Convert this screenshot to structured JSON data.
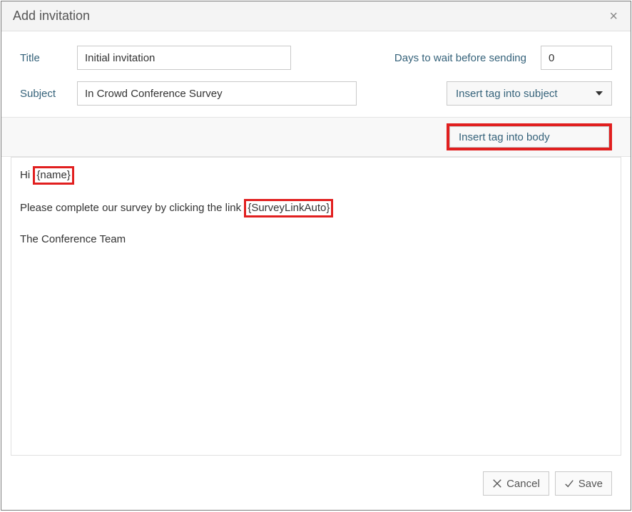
{
  "dialog": {
    "title": "Add invitation",
    "close_symbol": "×"
  },
  "form": {
    "title_label": "Title",
    "title_value": "Initial invitation",
    "days_label": "Days to wait before sending",
    "days_value": "0",
    "subject_label": "Subject",
    "subject_value": "In Crowd Conference Survey"
  },
  "dropdowns": {
    "subject_tag_label": "Insert tag into subject",
    "body_tag_label": "Insert tag into body"
  },
  "body": {
    "greeting_prefix": "Hi ",
    "greeting_tag": "{name}",
    "line2_prefix": "Please complete our survey by clicking the link ",
    "line2_tag": "{SurveyLinkAuto}",
    "signature": "The Conference Team"
  },
  "footer": {
    "cancel_label": "Cancel",
    "save_label": "Save"
  }
}
